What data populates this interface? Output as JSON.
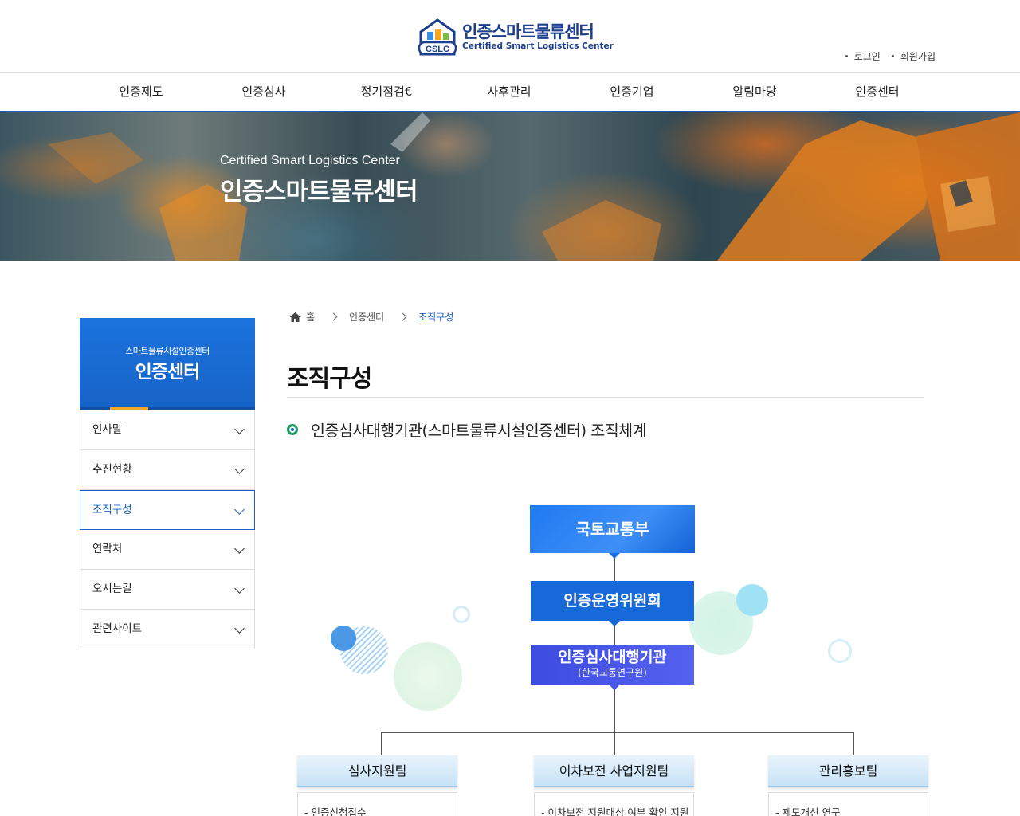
{
  "header": {
    "logo_title": "인증스마트물류센터",
    "logo_sub": "Certified Smart Logistics Center",
    "logo_mark_text": "CSLC",
    "util": [
      "로그인",
      "회원가입"
    ]
  },
  "gnb": [
    "인증제도",
    "인증심사",
    "정기점검€",
    "사후관리",
    "인증기업",
    "알림마당",
    "인증센터"
  ],
  "visual": {
    "en": "Certified Smart Logistics Center",
    "ko": "인증스마트물류센터"
  },
  "lnb": {
    "sub": "스마트물류시설인증센터",
    "title": "인증센터",
    "items": [
      "인사말",
      "추진현황",
      "조직구성",
      "연락처",
      "오시는길",
      "관련사이트"
    ],
    "active": "조직구성"
  },
  "breadcrumb": {
    "home": "홈",
    "level1": "인증센터",
    "current": "조직구성"
  },
  "page_title": "조직구성",
  "section_title": "인증심사대행기관(스마트물류시설인증센터) 조직체계",
  "org": {
    "ministry": "국토교통부",
    "committee": "인증운영위원회",
    "agency": "인증심사대행기관",
    "agency_sub": "(한국교통연구원)",
    "teams": [
      {
        "name": "심사지원팀",
        "duty": "- 인증신청접수"
      },
      {
        "name": "이차보전 사업지원팀",
        "duty": "- 이차보전 지원대상 여부 확인 지원"
      },
      {
        "name": "관리홍보팀",
        "duty": "- 제도개선 연구"
      }
    ]
  },
  "colors": {
    "primary": "#1b5fc5",
    "accent": "#f5a623",
    "agency": "#4a55e8"
  }
}
